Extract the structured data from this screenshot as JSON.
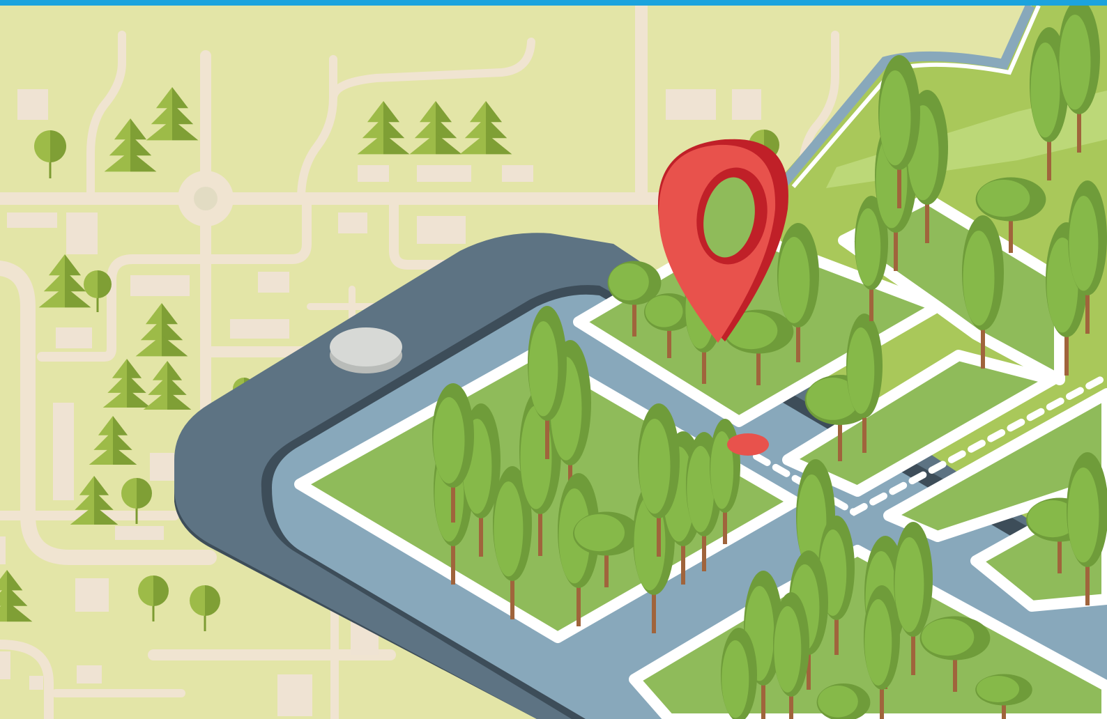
{
  "colors": {
    "top_bar": "#1ca3dd",
    "map_background": "#e3e5a7",
    "map_background_light": "#e7ebb4",
    "road": "#f0e4d1",
    "block": "#efe3d3",
    "tree_dark": "#7f9f35",
    "tree_light": "#9dbb48",
    "trunk_map": "#7c9b32",
    "phone_body": "#5d7383",
    "phone_side": "#3d4d59",
    "phone_edge": "#8ea1ad",
    "home_button": "#d7d9d6",
    "screen_street": "#88a8bb",
    "street_line": "#ffffff",
    "grass": "#8fbb5a",
    "grass_light": "#9cc95a",
    "iso_tree_dark": "#6f9c3a",
    "iso_tree_light": "#86b949",
    "iso_trunk": "#a0643c",
    "pin_red": "#e8524c",
    "pin_dark": "#c02028",
    "location_dot": "#e8524c",
    "mountain": "#a9c85a",
    "mountain_light": "#bcd878"
  },
  "icons": {
    "pin": "map-pin-icon",
    "dot": "location-dot-icon",
    "button": "home-button-icon"
  }
}
